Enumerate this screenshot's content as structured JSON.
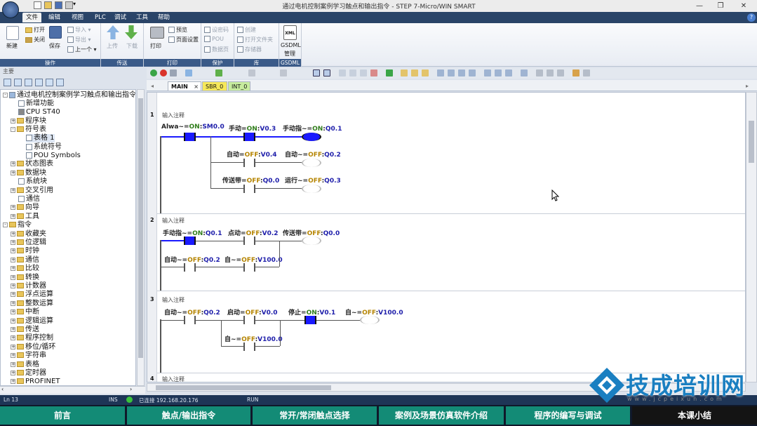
{
  "window": {
    "title": "通过电机控制案例学习触点和输出指令 - STEP 7-Micro/WIN SMART",
    "help": "?"
  },
  "menu": [
    "文件",
    "编辑",
    "视图",
    "PLC",
    "调试",
    "工具",
    "帮助"
  ],
  "ribbon": {
    "groups": [
      "操作",
      "传送",
      "打印",
      "保护",
      "库",
      "GSDML"
    ],
    "buttons": {
      "new": "新建",
      "open": "打开",
      "close": "关闭",
      "save": "保存",
      "import": "导入",
      "export": "导出",
      "previous": "上一个",
      "upload": "上传",
      "download": "下载",
      "print": "打印",
      "preview": "预览",
      "page_setup": "页面设置",
      "set_password": "设密码",
      "pou": "POU",
      "data_page": "数据页",
      "create": "创建",
      "open_folder": "打开文件夹",
      "memory": "存储器",
      "gsdml": "GSDML",
      "gsdml_manage": "管理",
      "xml": "XML"
    }
  },
  "nav": {
    "title": "主要",
    "project_tree": [
      "通过电机控制案例学习触点和输出指令",
      "新增功能",
      "CPU ST40",
      "程序块",
      "符号表",
      "表格 1",
      "系统符号",
      "POU Symbols",
      "状态图表",
      "数据块",
      "系统块",
      "交叉引用",
      "通信",
      "向导",
      "工具"
    ],
    "instruction_tree": [
      "指令",
      "收藏夹",
      "位逻辑",
      "时钟",
      "通信",
      "比较",
      "转换",
      "计数器",
      "浮点运算",
      "整数运算",
      "中断",
      "逻辑运算",
      "传送",
      "程序控制",
      "移位/循环",
      "字符串",
      "表格",
      "定时器",
      "PROFINET"
    ]
  },
  "editor": {
    "tabs": [
      "MAIN",
      "SBR_0",
      "INT_0"
    ],
    "tab_close": "×",
    "networks": [
      {
        "num": "1",
        "comment": "输入注释",
        "elements": [
          {
            "name": "Alwa~",
            "state": "ON",
            "addr": "SM0.0"
          },
          {
            "name": "手动",
            "state": "ON",
            "addr": "V0.3"
          },
          {
            "name": "手动指~",
            "state": "ON",
            "addr": "Q0.1"
          },
          {
            "name": "自动",
            "state": "OFF",
            "addr": "V0.4"
          },
          {
            "name": "自动~",
            "state": "OFF",
            "addr": "Q0.2"
          },
          {
            "name": "传送带",
            "state": "OFF",
            "addr": "Q0.0"
          },
          {
            "name": "运行~",
            "state": "OFF",
            "addr": "Q0.3"
          }
        ]
      },
      {
        "num": "2",
        "comment": "输入注释",
        "elements": [
          {
            "name": "手动指~",
            "state": "ON",
            "addr": "Q0.1"
          },
          {
            "name": "点动",
            "state": "OFF",
            "addr": "V0.2"
          },
          {
            "name": "传送带",
            "state": "OFF",
            "addr": "Q0.0"
          },
          {
            "name": "自动~",
            "state": "OFF",
            "addr": "Q0.2"
          },
          {
            "name": "自~",
            "state": "OFF",
            "addr": "V100.0"
          }
        ]
      },
      {
        "num": "3",
        "comment": "输入注释",
        "elements": [
          {
            "name": "自动~",
            "state": "OFF",
            "addr": "Q0.2"
          },
          {
            "name": "启动",
            "state": "OFF",
            "addr": "V0.0"
          },
          {
            "name": "停止",
            "state": "ON",
            "addr": "V0.1"
          },
          {
            "name": "自~",
            "state": "OFF",
            "addr": "V100.0"
          },
          {
            "name": "自~",
            "state": "OFF",
            "addr": "V100.0"
          }
        ]
      },
      {
        "num": "4",
        "comment": "输入注释"
      }
    ]
  },
  "status": {
    "position": "Ln 13",
    "ins": "INS",
    "connection": "已连接 192.168.20.176",
    "mode": "RUN"
  },
  "course_nav": [
    "前言",
    "触点/输出指令",
    "常开/常闭触点选择",
    "案例及场景仿真软件介绍",
    "程序的编写与调试",
    "本课小结"
  ],
  "watermark": {
    "text": "技成培训网",
    "url": "www.jcpeixun.com"
  },
  "colors": {
    "menubar": "#2a4468",
    "course_tab": "#138b76",
    "course_tab_current": "#141414",
    "energized": "#1a1aff",
    "on_state": "#2f7d1a",
    "off_state": "#b58400"
  }
}
